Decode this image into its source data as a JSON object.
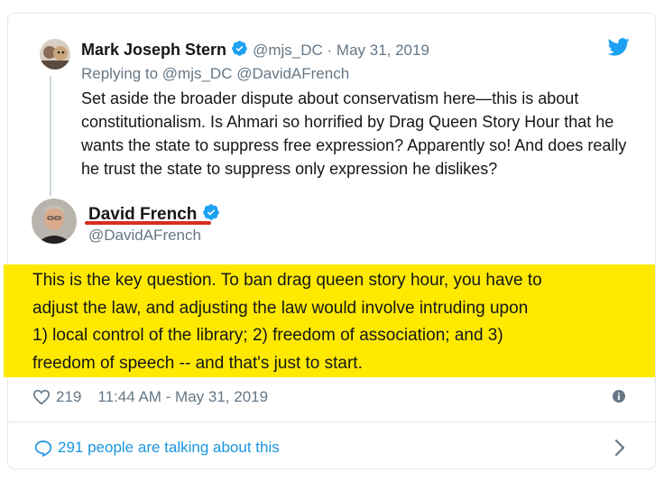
{
  "reply_tweet": {
    "author_name": "Mark Joseph Stern",
    "handle_date": "@mjs_DC · May 31, 2019",
    "replying_to": "Replying to @mjs_DC @DavidAFrench",
    "text": "Set aside the broader dispute about conservatism here—this is about constitutionalism. Is Ahmari so horrified by Drag Queen Story Hour that he wants the state to suppress free expression? Apparently so! And does really he trust the state to suppress only expression he dislikes?"
  },
  "main_tweet": {
    "author_name": "David French",
    "handle": "@DavidAFrench",
    "lines": [
      "This is the key question. To ban drag queen story hour, you have to",
      "adjust the law, and adjusting the law would involve intruding upon",
      "1) local control of the library; 2) freedom of association; and 3)",
      "freedom of speech -- and that's just to start."
    ],
    "likes": "219",
    "timestamp": "11:44 AM - May 31, 2019"
  },
  "conversation_link": "291 people are talking about this",
  "colors": {
    "accent": "#1da1f2",
    "highlight": "#ffe900",
    "underline": "#d62d20",
    "muted": "#657786"
  },
  "icons": [
    "twitter-bird-icon",
    "verified-badge-icon",
    "heart-icon",
    "info-icon",
    "speech-bubble-icon",
    "chevron-right-icon"
  ]
}
